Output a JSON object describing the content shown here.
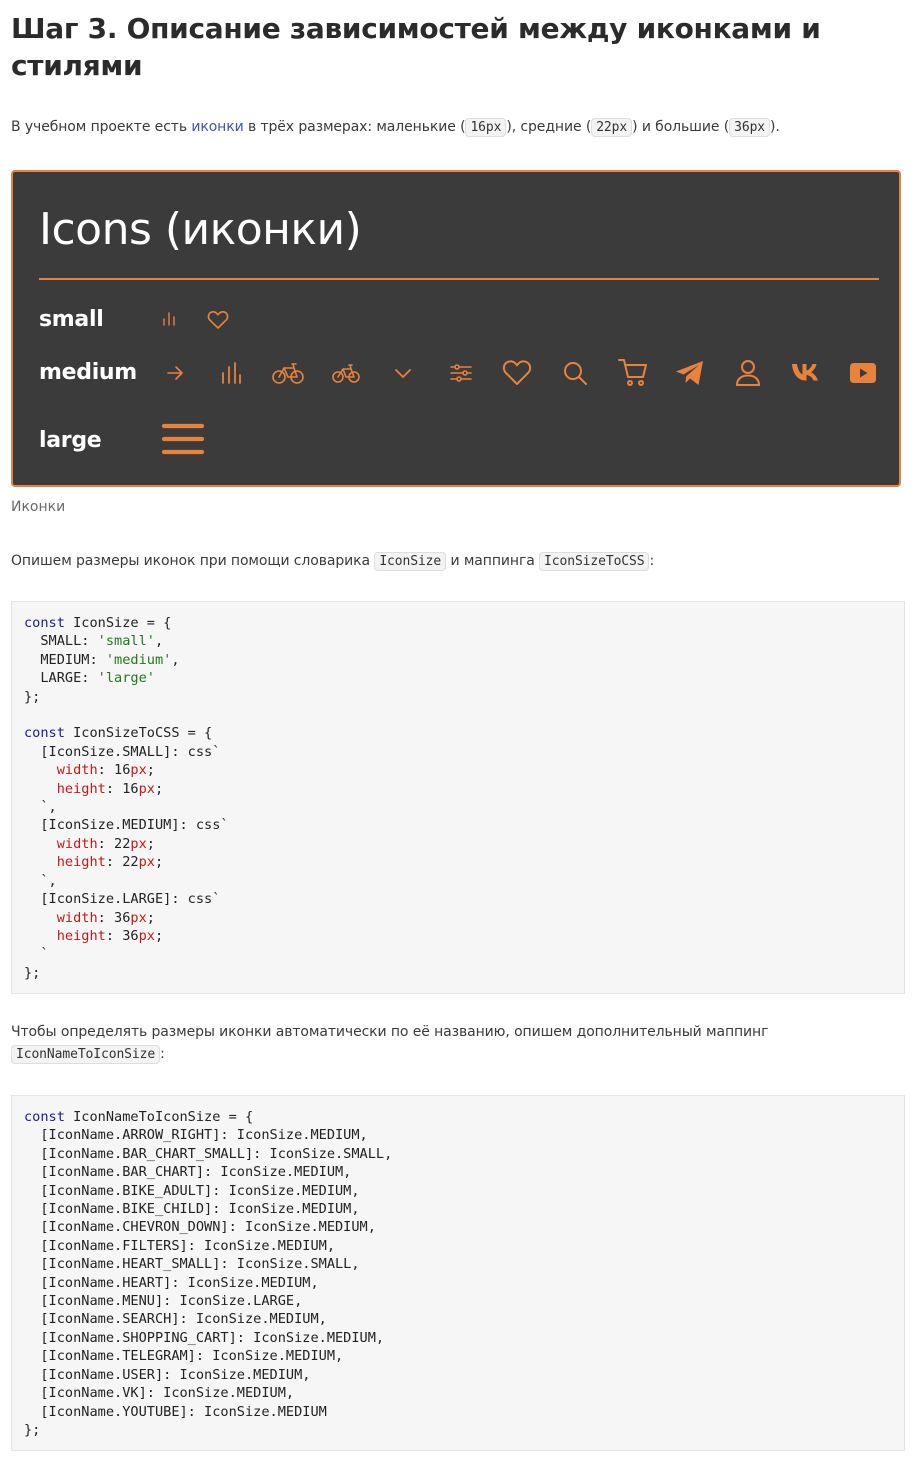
{
  "heading": "Шаг 3. Описание зависимостей между иконками и стилями",
  "intro": {
    "text1": "В учебном проекте есть ",
    "link": "иконки",
    "text2": " в трёх размерах: маленькие (",
    "small": "16px",
    "text3": "), средние (",
    "medium": "22px",
    "text4": ") и большие (",
    "large": "36px",
    "text5": ")."
  },
  "demo": {
    "title": "Icons (иконки)",
    "rows": {
      "small": "small",
      "medium": "medium",
      "large": "large"
    },
    "accent": "#e8823c",
    "background": "#3c3b3b",
    "small_icons": [
      "bar-chart-small-icon",
      "heart-small-icon"
    ],
    "medium_icons": [
      "arrow-right-icon",
      "bar-chart-icon",
      "bike-adult-icon",
      "bike-child-icon",
      "chevron-down-icon",
      "filters-icon",
      "heart-icon",
      "search-icon",
      "shopping-cart-icon",
      "telegram-icon",
      "user-icon",
      "vk-icon",
      "youtube-icon"
    ],
    "large_icons": [
      "menu-icon"
    ]
  },
  "caption": "Иконки",
  "para2": {
    "text1": "Опишем размеры иконок при помощи словарика ",
    "code1": "IconSize",
    "text2": " и маппинга ",
    "code2": "IconSizeToCSS",
    "text3": ":"
  },
  "para3": {
    "text1": "Чтобы определять размеры иконки автоматически по её названию, опишем дополнительный маппинг",
    "code1": "IconNameToIconSize",
    "text2": ":"
  },
  "code_block_1": {
    "kw_const": "const",
    "name1": " IconSize = {",
    "entries": [
      {
        "key": "  SMALL: ",
        "val": "'small'",
        "end": ","
      },
      {
        "key": "  MEDIUM: ",
        "val": "'medium'",
        "end": ","
      },
      {
        "key": "  LARGE: ",
        "val": "'large'",
        "end": ""
      }
    ],
    "close1": "};",
    "name2": " IconSizeToCSS = {",
    "groups": [
      {
        "head": "  [IconSize.SMALL]: css`",
        "w": "16",
        "h": "16"
      },
      {
        "head": "  [IconSize.MEDIUM]: css`",
        "w": "22",
        "h": "22"
      },
      {
        "head": "  [IconSize.LARGE]: css`",
        "w": "36",
        "h": "36"
      }
    ],
    "width_prop": "width",
    "height_prop": "height",
    "unit": "px",
    "close2": "};"
  },
  "code_block_2": {
    "kw_const": "const",
    "name": " IconNameToIconSize = {",
    "lines": [
      "  [IconName.ARROW_RIGHT]: IconSize.MEDIUM,",
      "  [IconName.BAR_CHART_SMALL]: IconSize.SMALL,",
      "  [IconName.BAR_CHART]: IconSize.MEDIUM,",
      "  [IconName.BIKE_ADULT]: IconSize.MEDIUM,",
      "  [IconName.BIKE_CHILD]: IconSize.MEDIUM,",
      "  [IconName.CHEVRON_DOWN]: IconSize.MEDIUM,",
      "  [IconName.FILTERS]: IconSize.MEDIUM,",
      "  [IconName.HEART_SMALL]: IconSize.SMALL,",
      "  [IconName.HEART]: IconSize.MEDIUM,",
      "  [IconName.MENU]: IconSize.LARGE,",
      "  [IconName.SEARCH]: IconSize.MEDIUM,",
      "  [IconName.SHOPPING_CART]: IconSize.MEDIUM,",
      "  [IconName.TELEGRAM]: IconSize.MEDIUM,",
      "  [IconName.USER]: IconSize.MEDIUM,",
      "  [IconName.VK]: IconSize.MEDIUM,",
      "  [IconName.YOUTUBE]: IconSize.MEDIUM"
    ],
    "close": "};"
  }
}
